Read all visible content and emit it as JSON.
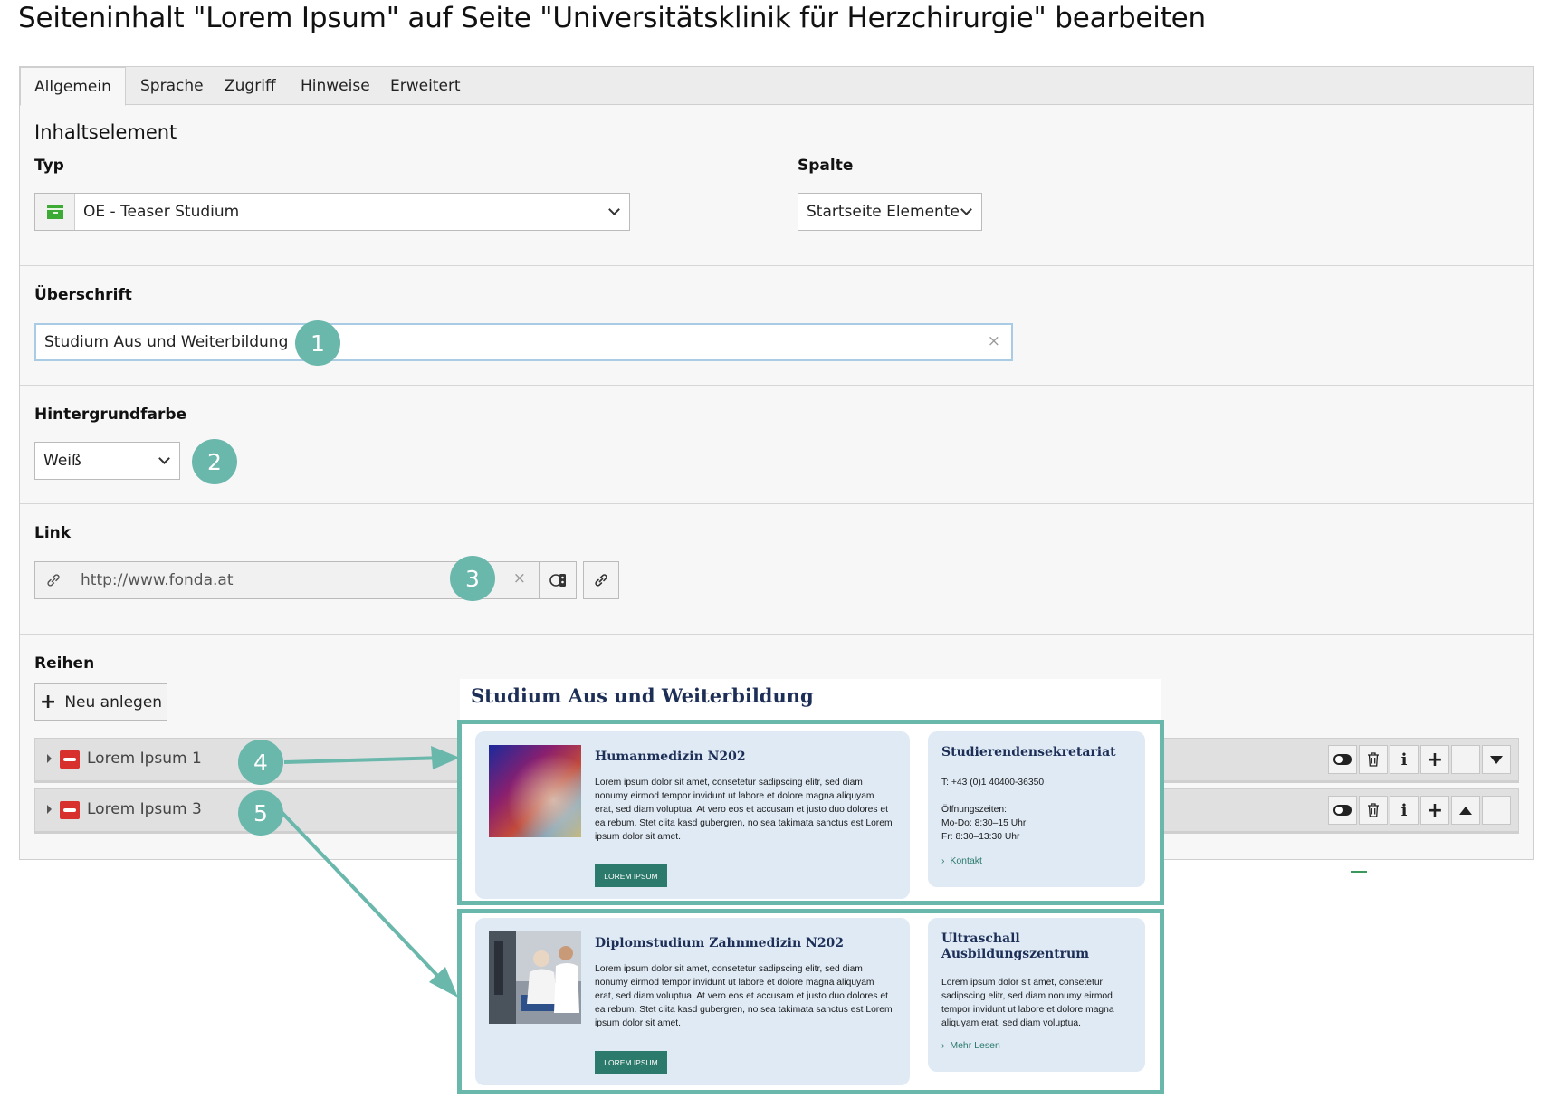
{
  "page_title": "Seiteninhalt \"Lorem Ipsum\" auf Seite \"Universitätsklinik für Herzchirurgie\" bearbeiten",
  "tabs": [
    {
      "label": "Allgemein",
      "active": true
    },
    {
      "label": "Sprache"
    },
    {
      "label": "Zugriff"
    },
    {
      "label": "Hinweise"
    },
    {
      "label": "Erweitert"
    }
  ],
  "content_element": {
    "heading": "Inhaltselement",
    "type_label": "Typ",
    "type_value": "OE - Teaser Studium",
    "type_icon": "content-element-icon",
    "column_label": "Spalte",
    "column_value": "Startseite Elemente"
  },
  "headline": {
    "label": "Überschrift",
    "value": "Studium Aus und Weiterbildung",
    "clear": "×"
  },
  "background": {
    "label": "Hintergrundfarbe",
    "value": "Weiß"
  },
  "link": {
    "label": "Link",
    "value": "http://www.fonda.at",
    "clear": "×",
    "icons": [
      "link-icon",
      "record-browser-icon",
      "link-browser-icon"
    ]
  },
  "rows": {
    "label": "Reihen",
    "new_button": "Neu anlegen",
    "items": [
      {
        "label": "Lorem Ipsum 1",
        "move": "down"
      },
      {
        "label": "Lorem Ipsum 3",
        "move": "up"
      }
    ],
    "info_glyph": "i",
    "add_glyph": "+"
  },
  "badges": [
    "1",
    "2",
    "3",
    "4",
    "5"
  ],
  "preview": {
    "title": "Studium Aus und Weiterbildung",
    "cards": [
      {
        "title": "Humanmedizin N202",
        "text": "Lorem ipsum dolor sit amet, consetetur sadipscing elitr, sed diam nonumy eirmod tempor invidunt ut labore et dolore magna aliquyam erat, sed diam voluptua. At vero eos et accusam et justo duo dolores et ea rebum. Stet clita kasd gubergren, no sea takimata sanctus est Lorem ipsum dolor sit amet.",
        "button": "LOREM IPSUM",
        "side_title": "Studierendensekretariat",
        "side_lines": [
          "T: +43 (0)1 40400-36350",
          "Öffnungszeiten:",
          "Mo-Do: 8:30–15 Uhr",
          "Fr: 8:30–13:30 Uhr"
        ],
        "side_link": "Kontakt"
      },
      {
        "title": "Diplomstudium Zahnmedizin N202",
        "text": "Lorem ipsum dolor sit amet, consetetur sadipscing elitr, sed diam nonumy eirmod tempor invidunt ut labore et dolore magna aliquyam erat, sed diam voluptua. At vero eos et accusam et justo duo dolores et ea rebum. Stet clita kasd gubergren, no sea takimata sanctus est Lorem ipsum dolor sit amet.",
        "button": "LOREM IPSUM",
        "side_title_1": "Ultraschall",
        "side_title_2": "Ausbildungszentrum",
        "side_text": "Lorem ipsum dolor sit amet, consetetur sadipscing elitr, sed diam nonumy eirmod tempor invidunt ut labore et dolore magna aliquyam erat, sed diam voluptua.",
        "side_link": "Mehr Lesen"
      }
    ]
  },
  "colors": {
    "accent_teal": "#6ab7ac",
    "brand_navy": "#1d2f57",
    "button_green": "#2c7a6b",
    "card_bg": "#dfeaf5"
  }
}
